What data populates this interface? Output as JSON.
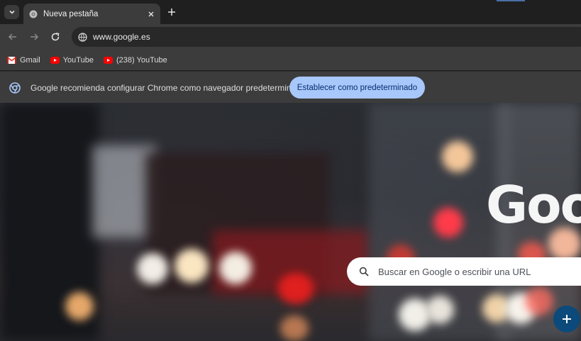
{
  "browser": {
    "tab": {
      "title": "Nueva pestaña"
    },
    "toolbar": {
      "url": "www.google.es"
    },
    "bookmarks": [
      {
        "label": "Gmail",
        "icon": "gmail-icon"
      },
      {
        "label": "YouTube",
        "icon": "youtube-icon"
      },
      {
        "label": "(238) YouTube",
        "icon": "youtube-icon"
      }
    ],
    "infobar": {
      "message": "Google recomienda configurar Chrome como navegador predeterminado",
      "button_label": "Establecer como predeterminado"
    }
  },
  "page": {
    "logo_text": "Goo",
    "search": {
      "placeholder": "Buscar en Google o escribir una URL"
    },
    "fab_label": "+"
  },
  "colors": {
    "accent_button": "#a8c7fa",
    "fab": "#0b4a7a",
    "youtube_red": "#ff0000",
    "gmail_red": "#ea4335"
  }
}
